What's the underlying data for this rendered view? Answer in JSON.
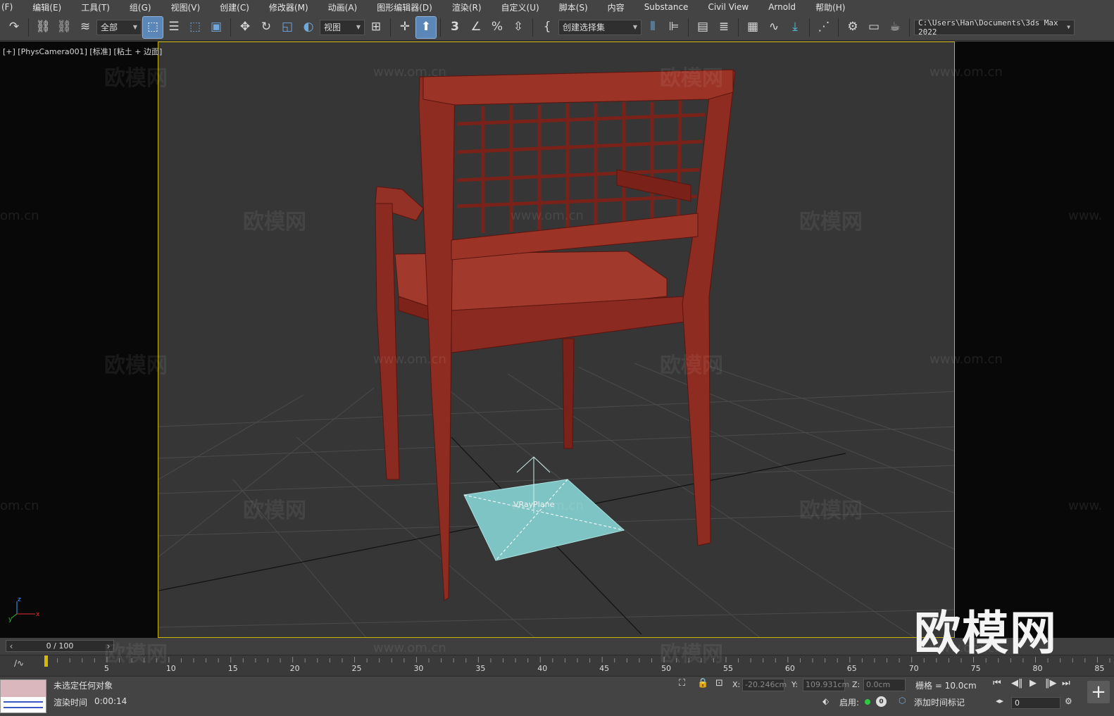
{
  "menu": [
    "(F)",
    "编辑(E)",
    "工具(T)",
    "组(G)",
    "视图(V)",
    "创建(C)",
    "修改器(M)",
    "动画(A)",
    "图形编辑器(D)",
    "渲染(R)",
    "自定义(U)",
    "脚本(S)",
    "内容",
    "Substance",
    "Civil View",
    "Arnold",
    "帮助(H)"
  ],
  "toolbar": {
    "selection_filter": "全部",
    "reference_coord": "视图",
    "named_selection": "创建选择集",
    "project_path": "C:\\Users\\Han\\Documents\\3ds Max 2022",
    "icons": [
      "undo-icon",
      "link-icon",
      "unlink-icon",
      "bind-spacewarp-icon",
      "select-object-icon",
      "select-by-name-icon",
      "rect-select-icon",
      "window-crossing-icon",
      "move-icon",
      "rotate-icon",
      "scale-icon",
      "placement-icon",
      "pivot-icon",
      "snap-3d-icon",
      "angle-snap-icon",
      "percent-snap-icon",
      "spinner-snap-icon",
      "edit-named-sel-icon",
      "mirror-icon",
      "align-icon",
      "scene-explorer-icon",
      "layer-explorer-icon",
      "ribbon-icon",
      "curve-editor-icon",
      "schematic-icon",
      "material-editor-icon",
      "render-setup-icon",
      "rendered-frame-icon",
      "render-icon"
    ]
  },
  "viewport": {
    "label": "[+] [PhysCamera001] [标准] [粘土 + 边面]",
    "object_label": "VRayPlane",
    "watermark_text": "欧模网",
    "watermark_url": "www.om.cn",
    "watermark_partial": "om.cn",
    "watermark_url_partial": "www.",
    "big_logo": "欧模网",
    "axis_labels": {
      "z": "z",
      "y": "y",
      "x": "x"
    },
    "colors": {
      "chair": "#8a2a20",
      "chair_dark": "#5a140e",
      "plane": "#7fc4c4",
      "frame": "#c8b400",
      "background": "#363636"
    }
  },
  "timeline": {
    "frame_display": "0 / 100",
    "ticks": [
      "5",
      "10",
      "15",
      "20",
      "25",
      "30",
      "35",
      "40",
      "45",
      "50",
      "55",
      "60",
      "65",
      "70",
      "75",
      "80",
      "85"
    ],
    "current_frame": 0,
    "total_frames": 100
  },
  "status": {
    "selection_msg": "未选定任何对象",
    "render_time_label": "渲染时间",
    "render_time_value": "0:00:14",
    "x_label": "X:",
    "x_value": "-20.246cm",
    "y_label": "Y:",
    "y_value": "109.931cm",
    "z_label": "Z:",
    "z_value": "0.0cm",
    "grid": "栅格 = 10.0cm",
    "enable_label": "启用:",
    "counter": "0",
    "add_time_tag": "添加时间标记",
    "frame_value": "0"
  }
}
